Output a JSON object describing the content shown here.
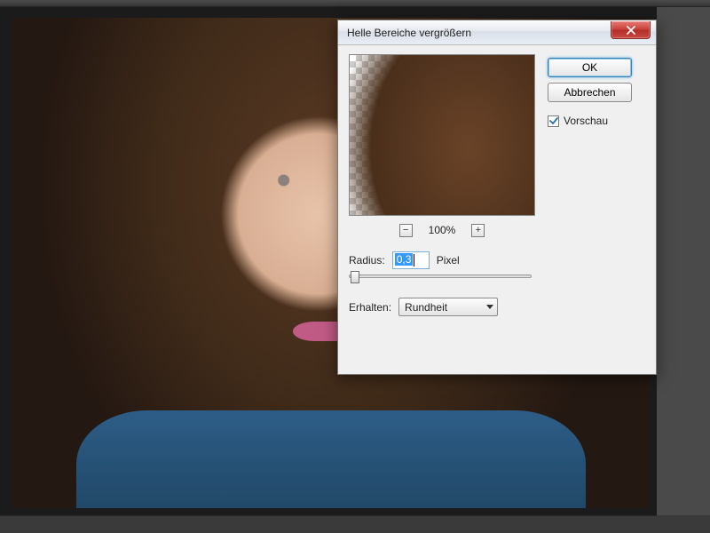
{
  "dialog": {
    "title": "Helle Bereiche vergrößern",
    "close_glyph": "✕",
    "zoom": {
      "minus": "−",
      "level": "100%",
      "plus": "+"
    },
    "radius": {
      "label": "Radius:",
      "value": "0,3",
      "unit": "Pixel"
    },
    "preserve": {
      "label": "Erhalten:",
      "value": "Rundheit"
    },
    "buttons": {
      "ok": "OK",
      "cancel": "Abbrechen"
    },
    "preview_checkbox": {
      "checked": true,
      "label": "Vorschau"
    }
  }
}
